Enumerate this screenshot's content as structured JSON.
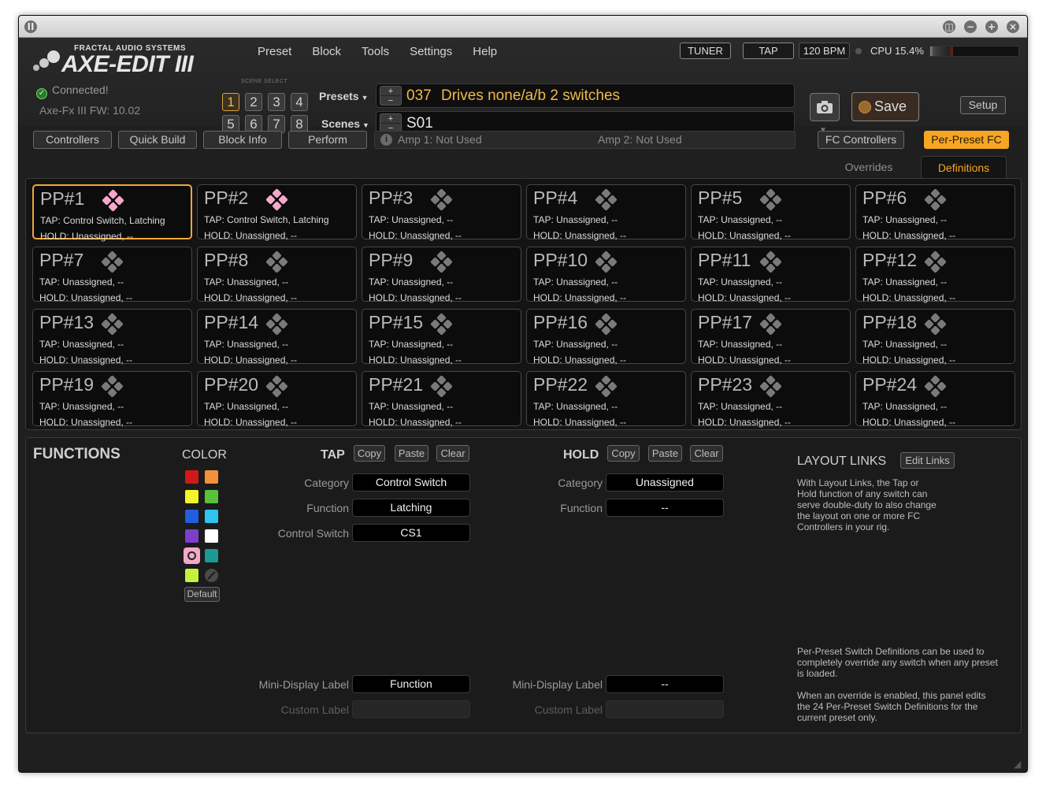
{
  "titlebar": {
    "left_icon": "pause-icon",
    "right_icons": [
      "pin-icon",
      "minimize-icon",
      "maximize-icon",
      "close-icon"
    ]
  },
  "logo": {
    "brand": "FRACTAL AUDIO SYSTEMS",
    "name": "AXE-EDIT III"
  },
  "menu": [
    "Preset",
    "Block",
    "Tools",
    "Settings",
    "Help"
  ],
  "header": {
    "tuner": "TUNER",
    "tap": "TAP",
    "bpm": "120 BPM",
    "cpu": "CPU 15.4%",
    "cpu_fraction": 0.154,
    "connected": "Connected!",
    "firmware": "Axe-Fx III FW: 10.02",
    "scene_select_label": "SCENE SELECT",
    "scene_buttons": [
      "1",
      "2",
      "3",
      "4",
      "5",
      "6",
      "7",
      "8"
    ],
    "active_scene": "1",
    "presets_label": "Presets",
    "scenes_label": "Scenes",
    "preset_number": "037",
    "preset_name": "Drives none/a/b 2 switches",
    "scene_number": "S01",
    "scene_name": "",
    "save": "Save",
    "setup": "Setup"
  },
  "tabs": {
    "controllers": "Controllers",
    "quick_build": "Quick Build",
    "block_info": "Block Info",
    "perform": "Perform",
    "amp1": "Amp 1: Not Used",
    "amp2": "Amp 2: Not Used",
    "fc_controllers": "FC Controllers",
    "per_preset_fc": "Per-Preset FC"
  },
  "subtabs": {
    "overrides": "Overrides",
    "definitions": "Definitions"
  },
  "switches": [
    {
      "name": "PP#1",
      "tap": "TAP: Control Switch, Latching",
      "hold": "HOLD: Unassigned, --",
      "color": "pink",
      "selected": true
    },
    {
      "name": "PP#2",
      "tap": "TAP: Control Switch, Latching",
      "hold": "HOLD: Unassigned, --",
      "color": "pink"
    },
    {
      "name": "PP#3",
      "tap": "TAP: Unassigned, --",
      "hold": "HOLD: Unassigned, --"
    },
    {
      "name": "PP#4",
      "tap": "TAP: Unassigned, --",
      "hold": "HOLD: Unassigned, --"
    },
    {
      "name": "PP#5",
      "tap": "TAP: Unassigned, --",
      "hold": "HOLD: Unassigned, --"
    },
    {
      "name": "PP#6",
      "tap": "TAP: Unassigned, --",
      "hold": "HOLD: Unassigned, --"
    },
    {
      "name": "PP#7",
      "tap": "TAP: Unassigned, --",
      "hold": "HOLD: Unassigned, --"
    },
    {
      "name": "PP#8",
      "tap": "TAP: Unassigned, --",
      "hold": "HOLD: Unassigned, --"
    },
    {
      "name": "PP#9",
      "tap": "TAP: Unassigned, --",
      "hold": "HOLD: Unassigned, --"
    },
    {
      "name": "PP#10",
      "tap": "TAP: Unassigned, --",
      "hold": "HOLD: Unassigned, --"
    },
    {
      "name": "PP#11",
      "tap": "TAP: Unassigned, --",
      "hold": "HOLD: Unassigned, --"
    },
    {
      "name": "PP#12",
      "tap": "TAP: Unassigned, --",
      "hold": "HOLD: Unassigned, --"
    },
    {
      "name": "PP#13",
      "tap": "TAP: Unassigned, --",
      "hold": "HOLD: Unassigned, --"
    },
    {
      "name": "PP#14",
      "tap": "TAP: Unassigned, --",
      "hold": "HOLD: Unassigned, --"
    },
    {
      "name": "PP#15",
      "tap": "TAP: Unassigned, --",
      "hold": "HOLD: Unassigned, --"
    },
    {
      "name": "PP#16",
      "tap": "TAP: Unassigned, --",
      "hold": "HOLD: Unassigned, --"
    },
    {
      "name": "PP#17",
      "tap": "TAP: Unassigned, --",
      "hold": "HOLD: Unassigned, --"
    },
    {
      "name": "PP#18",
      "tap": "TAP: Unassigned, --",
      "hold": "HOLD: Unassigned, --"
    },
    {
      "name": "PP#19",
      "tap": "TAP: Unassigned, --",
      "hold": "HOLD: Unassigned, --"
    },
    {
      "name": "PP#20",
      "tap": "TAP: Unassigned, --",
      "hold": "HOLD: Unassigned, --"
    },
    {
      "name": "PP#21",
      "tap": "TAP: Unassigned, --",
      "hold": "HOLD: Unassigned, --"
    },
    {
      "name": "PP#22",
      "tap": "TAP: Unassigned, --",
      "hold": "HOLD: Unassigned, --"
    },
    {
      "name": "PP#23",
      "tap": "TAP: Unassigned, --",
      "hold": "HOLD: Unassigned, --"
    },
    {
      "name": "PP#24",
      "tap": "TAP: Unassigned, --",
      "hold": "HOLD: Unassigned, --"
    }
  ],
  "functions": {
    "title": "FUNCTIONS",
    "color_title": "COLOR",
    "colors": [
      "#d0191a",
      "#f2913a",
      "#f4f42a",
      "#58c23b",
      "#1f5fe0",
      "#2ec4ef",
      "#7b3fcb",
      "#ffffff",
      "#f6a8cb",
      "#1a9a93",
      "#c6f03a",
      "none"
    ],
    "selected_color": "#f6a8cb",
    "default_label": "Default",
    "tap": {
      "title": "TAP",
      "copy": "Copy",
      "paste": "Paste",
      "clear": "Clear",
      "category_label": "Category",
      "category": "Control Switch",
      "function_label": "Function",
      "function": "Latching",
      "control_switch_label": "Control Switch",
      "control_switch": "CS1",
      "mini_display_label": "Mini-Display Label",
      "mini_display": "Function",
      "custom_label": "Custom Label",
      "custom": ""
    },
    "hold": {
      "title": "HOLD",
      "copy": "Copy",
      "paste": "Paste",
      "clear": "Clear",
      "category_label": "Category",
      "category": "Unassigned",
      "function_label": "Function",
      "function": "--",
      "mini_display_label": "Mini-Display Label",
      "mini_display": "--",
      "custom_label": "Custom Label",
      "custom": ""
    },
    "layout_links": {
      "title": "LAYOUT LINKS",
      "edit": "Edit Links",
      "desc": "With Layout Links, the Tap or Hold function of any switch can serve double-duty to also change the layout on one or more FC Controllers in your rig.",
      "info1": "Per-Preset Switch Definitions can be used to completely override any switch when any preset is loaded.",
      "info2": "When an override is enabled, this panel edits the 24 Per-Preset Switch Definitions for the current preset only."
    }
  }
}
